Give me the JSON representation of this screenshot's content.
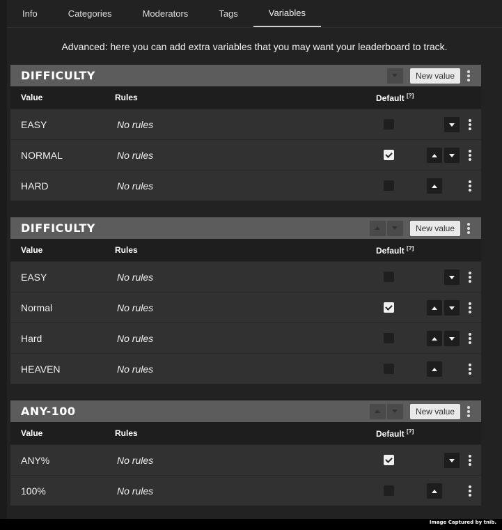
{
  "tabs": [
    {
      "label": "Info",
      "active": false
    },
    {
      "label": "Categories",
      "active": false
    },
    {
      "label": "Moderators",
      "active": false
    },
    {
      "label": "Tags",
      "active": false
    },
    {
      "label": "Variables",
      "active": true
    }
  ],
  "intro": "Advanced: here you can add extra variables that you may want your leaderboard to track.",
  "columns": {
    "value": "Value",
    "rules": "Rules",
    "default": "Default",
    "default_help": "[?]"
  },
  "new_value_label": "New value",
  "variables": [
    {
      "title": "DIFFICULTY",
      "rows": [
        {
          "value": "EASY",
          "rules": "No rules",
          "default": false,
          "up": false,
          "down": true
        },
        {
          "value": "NORMAL",
          "rules": "No rules",
          "default": true,
          "up": true,
          "down": true
        },
        {
          "value": "HARD",
          "rules": "No rules",
          "default": false,
          "up": true,
          "down": false
        }
      ]
    },
    {
      "title": "DIFFICULTY",
      "rows": [
        {
          "value": "EASY",
          "rules": "No rules",
          "default": false,
          "up": false,
          "down": true
        },
        {
          "value": "Normal",
          "rules": "No rules",
          "default": true,
          "up": true,
          "down": true
        },
        {
          "value": "Hard",
          "rules": "No rules",
          "default": false,
          "up": true,
          "down": true
        },
        {
          "value": "HEAVEN",
          "rules": "No rules",
          "default": false,
          "up": true,
          "down": false
        }
      ]
    },
    {
      "title": "ANY-100",
      "rows": [
        {
          "value": "ANY%",
          "rules": "No rules",
          "default": true,
          "up": false,
          "down": true
        },
        {
          "value": "100%",
          "rules": "No rules",
          "default": false,
          "up": true,
          "down": false
        }
      ]
    }
  ],
  "footer": {
    "capture_text": "Image Captured by tnib."
  },
  "colors": {
    "panel_header": "#5c5c5c",
    "row_bg": "#313131",
    "page_bg": "#222222"
  }
}
